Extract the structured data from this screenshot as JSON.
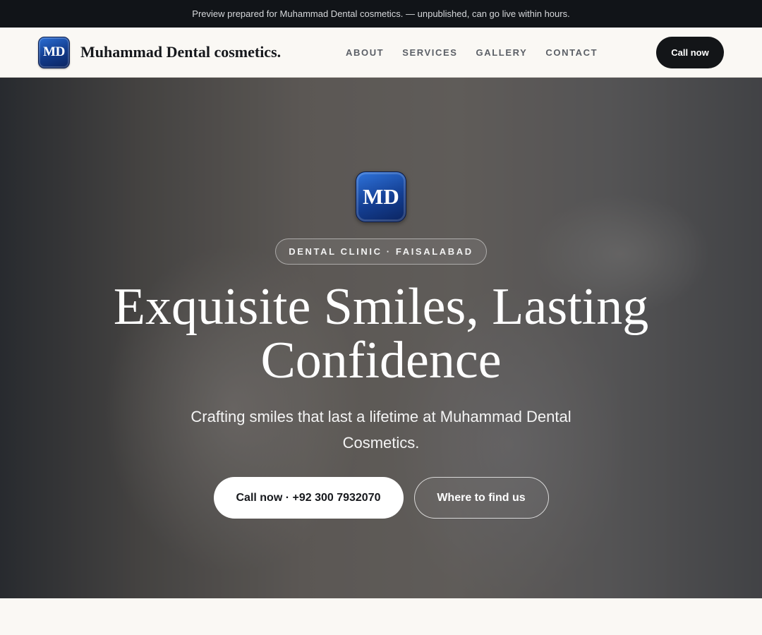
{
  "banner": {
    "text": "Preview prepared for Muhammad Dental cosmetics. — unpublished, can go live within hours."
  },
  "header": {
    "logo_text": "MD",
    "brand_name": "Muhammad Dental cosmetics.",
    "nav": [
      {
        "label": "ABOUT"
      },
      {
        "label": "SERVICES"
      },
      {
        "label": "GALLERY"
      },
      {
        "label": "CONTACT"
      }
    ],
    "call_label": "Call now"
  },
  "hero": {
    "logo_text": "MD",
    "eyebrow": "DENTAL CLINIC · FAISALABAD",
    "headline": "Exquisite Smiles, Lasting Confidence",
    "subhead": "Crafting smiles that last a lifetime at Muhammad Dental Cosmetics.",
    "cta_primary": "Call now · +92 300 7932070",
    "cta_secondary": "Where to find us",
    "background_image": "dental-clinic-photo"
  },
  "colors": {
    "banner_bg": "#111418",
    "dark_button": "#131518",
    "logo_blue": "#143f93",
    "page_bg": "#faf8f4"
  }
}
